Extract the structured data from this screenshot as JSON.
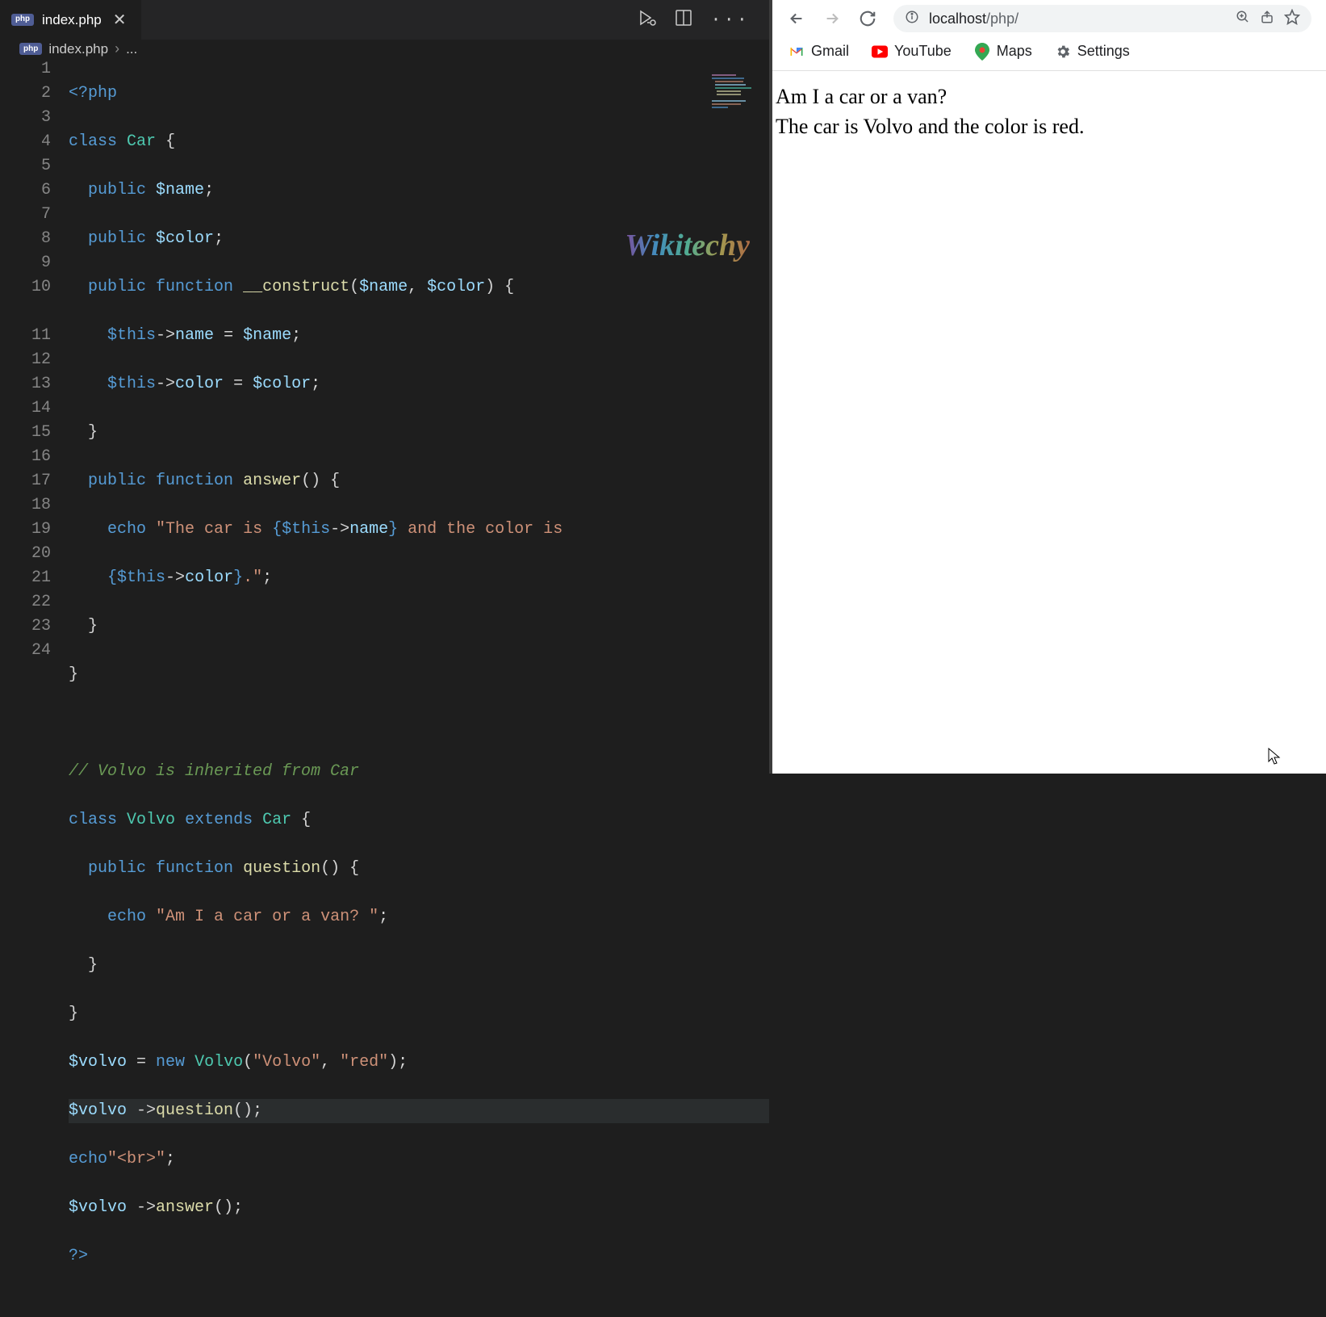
{
  "editor": {
    "tab_title": "index.php",
    "breadcrumb_file": "index.php",
    "breadcrumb_sep": "›",
    "breadcrumb_ellipsis": "...",
    "watermark": "Wikitechy",
    "line_numbers": [
      "1",
      "2",
      "3",
      "4",
      "5",
      "6",
      "7",
      "8",
      "9",
      "10",
      "11",
      "12",
      "13",
      "14",
      "15",
      "16",
      "17",
      "18",
      "19",
      "20",
      "21",
      "22",
      "23",
      "24"
    ],
    "code": {
      "l1": {
        "a": "<?",
        "b": "php"
      },
      "l2": {
        "a": "class",
        "b": "Car",
        "c": "{"
      },
      "l3": {
        "a": "public",
        "b": "$name",
        "c": ";"
      },
      "l4": {
        "a": "public",
        "b": "$color",
        "c": ";"
      },
      "l5": {
        "a": "public",
        "b": "function",
        "c": "__construct",
        "d": "(",
        "e": "$name",
        "f": ", ",
        "g": "$color",
        "h": ") {"
      },
      "l6": {
        "a": "$this",
        "b": "->",
        "c": "name",
        "d": " = ",
        "e": "$name",
        "f": ";"
      },
      "l7": {
        "a": "$this",
        "b": "->",
        "c": "color",
        "d": " = ",
        "e": "$color",
        "f": ";"
      },
      "l8": {
        "a": "}"
      },
      "l9": {
        "a": "public",
        "b": "function",
        "c": "answer",
        "d": "() {"
      },
      "l10": {
        "a": "echo",
        "b": "\"The car is ",
        "c": "{",
        "d": "$this",
        "e": "->",
        "f": "name",
        "g": "}",
        "h": " and the color is "
      },
      "l10b": {
        "a": "{",
        "b": "$this",
        "c": "->",
        "d": "color",
        "e": "}",
        "f": ".\"",
        "g": ";"
      },
      "l11": {
        "a": "}"
      },
      "l12": {
        "a": "}"
      },
      "l14": {
        "a": "// Volvo is inherited from Car"
      },
      "l15": {
        "a": "class",
        "b": "Volvo",
        "c": "extends",
        "d": "Car",
        "e": "{"
      },
      "l16": {
        "a": "public",
        "b": "function",
        "c": "question",
        "d": "() {"
      },
      "l17": {
        "a": "echo",
        "b": "\"Am I a car or a van? \"",
        "c": ";"
      },
      "l18": {
        "a": "}"
      },
      "l19": {
        "a": "}"
      },
      "l20": {
        "a": "$volvo",
        "b": " = ",
        "c": "new",
        "d": "Volvo",
        "e": "(",
        "f": "\"Volvo\"",
        "g": ", ",
        "h": "\"red\"",
        "i": ");"
      },
      "l21": {
        "a": "$volvo",
        "b": " ->",
        "c": "question",
        "d": "();"
      },
      "l22": {
        "a": "echo",
        "b": "\"<br>\"",
        "c": ";"
      },
      "l23": {
        "a": "$volvo",
        "b": " ->",
        "c": "answer",
        "d": "();"
      },
      "l24": {
        "a": "?>"
      }
    }
  },
  "browser": {
    "url_host": "localhost",
    "url_path": "/php/",
    "bookmarks": {
      "gmail": "Gmail",
      "youtube": "YouTube",
      "maps": "Maps",
      "settings": "Settings"
    },
    "output_line1": "Am I a car or a van?",
    "output_line2": "The car is Volvo and the color is red."
  }
}
